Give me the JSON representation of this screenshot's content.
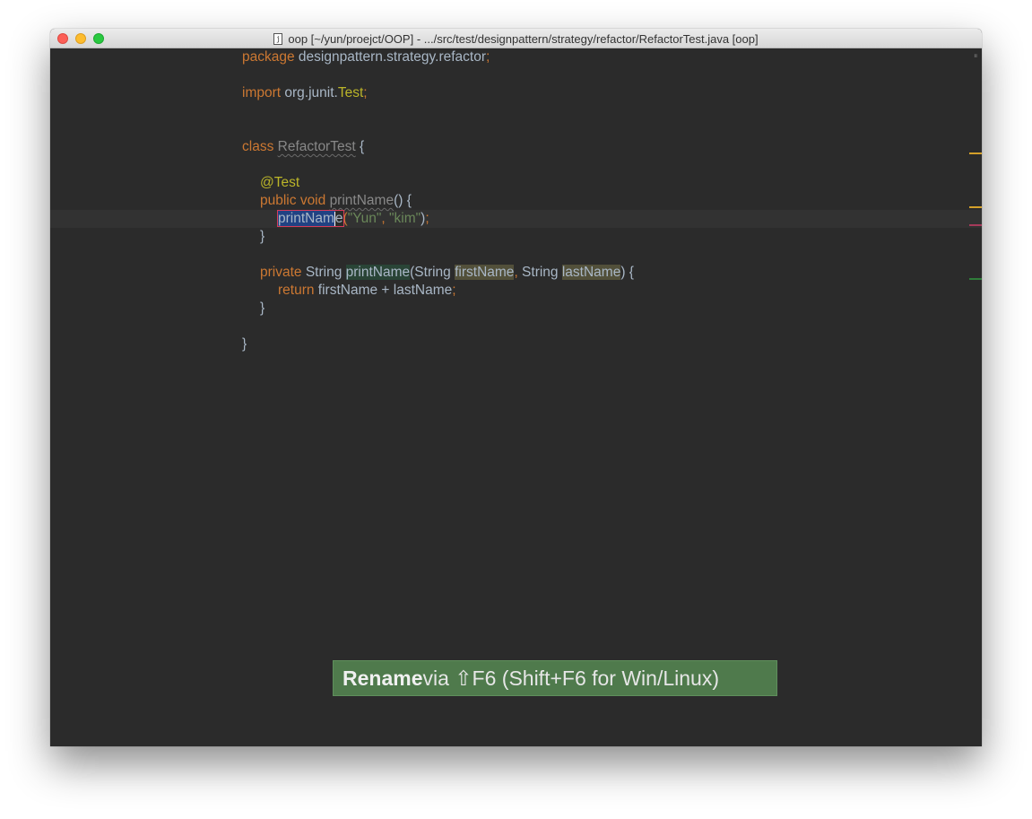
{
  "window": {
    "title": "oop [~/yun/proejct/OOP] - .../src/test/designpattern/strategy/refactor/RefactorTest.java [oop]",
    "file_icon_glyph": "j"
  },
  "code": {
    "l1": {
      "kw": "package",
      "rest": " designpattern.strategy.refactor",
      "semi": ";"
    },
    "l2": {
      "kw": "import",
      "rest": " org.junit.",
      "cls": "Test",
      "semi": ";"
    },
    "l3": {
      "kw": "class",
      "sp": " ",
      "name": "RefactorTest",
      "rest": " {"
    },
    "l4": {
      "ann": "@Test"
    },
    "l5": {
      "kw1": "public",
      "sp1": " ",
      "kw2": "void",
      "sp2": " ",
      "name": "printName",
      "rest": "() {"
    },
    "l6": {
      "name_a": "printNam",
      "name_b": "e",
      "p1": "(",
      "s1": "\"Yun\"",
      "comma": ", ",
      "s2": "\"kim\"",
      "p2": ")",
      "semi": ";"
    },
    "l7": {
      "rest": "}"
    },
    "l8": {
      "kw": "private",
      "t1": " String ",
      "name": "printName",
      "t2": "(String ",
      "p1": "firstName",
      "comma": ",",
      "t3": " String ",
      "p2": "lastName",
      "t4": ") {"
    },
    "l9": {
      "kw": "return",
      "rest": " firstName + lastName",
      "semi": ";"
    },
    "l10": {
      "rest": "}"
    },
    "l11": {
      "rest": "}"
    }
  },
  "tip": {
    "bold": "Rename",
    "rest": " via ⇧F6 (Shift+F6 for Win/Linux)"
  },
  "colors": {
    "background": "#2b2b2b",
    "keyword": "#cc7832",
    "annotation": "#bbb529",
    "string": "#6a8759",
    "tip_background": "#4f7a4c"
  }
}
